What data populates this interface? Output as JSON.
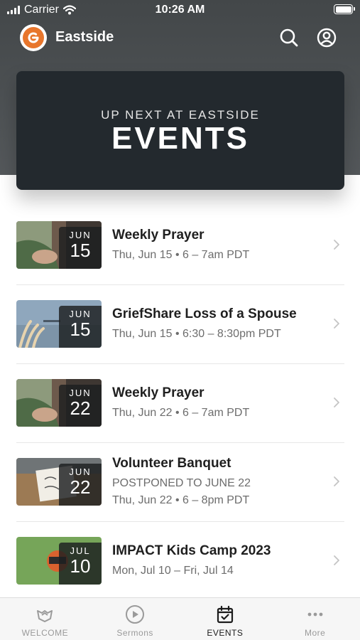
{
  "status_bar": {
    "carrier": "Carrier",
    "time": "10:26 AM"
  },
  "header": {
    "app_name": "Eastside"
  },
  "hero": {
    "kicker": "UP NEXT AT EASTSIDE",
    "title": "EVENTS"
  },
  "events": [
    {
      "month": "JUN",
      "day": "15",
      "title": "Weekly Prayer",
      "line1": "Thu, Jun 15 • 6 – 7am PDT",
      "line2": ""
    },
    {
      "month": "JUN",
      "day": "15",
      "title": "GriefShare Loss of a Spouse",
      "line1": "Thu, Jun 15 • 6:30 – 8:30pm PDT",
      "line2": ""
    },
    {
      "month": "JUN",
      "day": "22",
      "title": "Weekly Prayer",
      "line1": "Thu, Jun 22 • 6 – 7am PDT",
      "line2": ""
    },
    {
      "month": "JUN",
      "day": "22",
      "title": "Volunteer Banquet",
      "line1": "POSTPONED TO JUNE 22",
      "line2": "Thu, Jun 22 • 6 – 8pm PDT"
    },
    {
      "month": "JUL",
      "day": "10",
      "title": "IMPACT Kids Camp 2023",
      "line1": "Mon, Jul 10 – Fri, Jul 14",
      "line2": ""
    }
  ],
  "tabs": [
    {
      "label": "WELCOME",
      "icon": "church-icon",
      "active": false
    },
    {
      "label": "Sermons",
      "icon": "play-circle-icon",
      "active": false
    },
    {
      "label": "EVENTS",
      "icon": "calendar-icon",
      "active": true
    },
    {
      "label": "More",
      "icon": "more-dots-icon",
      "active": false
    }
  ],
  "colors": {
    "accent": "#e8762c",
    "header_bg": "#4a4e51",
    "hero_bg": "#23292e"
  }
}
